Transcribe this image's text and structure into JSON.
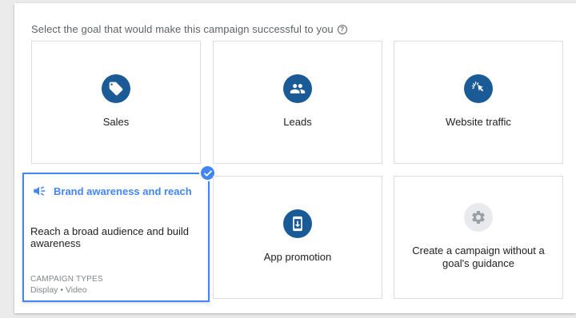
{
  "prompt": {
    "text": "Select the goal that would make this campaign successful to you",
    "help_glyph": "?"
  },
  "goals": [
    {
      "id": "sales",
      "label": "Sales",
      "icon": "tag-icon"
    },
    {
      "id": "leads",
      "label": "Leads",
      "icon": "people-icon"
    },
    {
      "id": "website_traffic",
      "label": "Website traffic",
      "icon": "cursor-click-icon"
    },
    {
      "id": "brand_awareness",
      "label": "Brand awareness and reach",
      "icon": "megaphone-icon",
      "selected": true,
      "description": "Reach a broad audience and build awareness",
      "campaign_types_label": "CAMPAIGN TYPES",
      "campaign_types": "Display • Video"
    },
    {
      "id": "app_promotion",
      "label": "App promotion",
      "icon": "phone-download-icon"
    },
    {
      "id": "no_goal",
      "label": "Create a campaign without a goal's guidance",
      "icon": "gear-icon"
    }
  ],
  "colors": {
    "icon_circle": "#1a5a97",
    "selected_accent": "#4285f4",
    "card_border": "#dadce0"
  }
}
